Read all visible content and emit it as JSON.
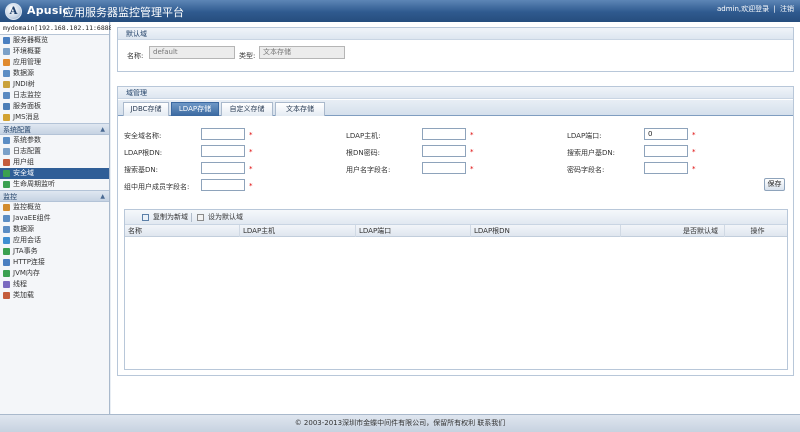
{
  "header": {
    "brand": "Apusic",
    "subtitle": "应用服务器监控管理平台",
    "user_status": "admin,欢迎登录",
    "separator": "|",
    "logout": "注销"
  },
  "sidebar": {
    "domain": "mydomain[192.168.102.11:6888]",
    "items_top": [
      {
        "label": "服务器概览",
        "color": "#4a7fc1"
      },
      {
        "label": "环境概要",
        "color": "#7aa0c8"
      },
      {
        "label": "应用管理",
        "color": "#e08a2e"
      },
      {
        "label": "数据源",
        "color": "#5b8dc4"
      },
      {
        "label": "JNDI树",
        "color": "#c9a23c"
      },
      {
        "label": "日志监控",
        "color": "#5a8ac2"
      },
      {
        "label": "服务面板",
        "color": "#4d7fb8"
      },
      {
        "label": "JMS消息",
        "color": "#d2a232"
      }
    ],
    "section_config": "系统配置",
    "items_config": [
      {
        "label": "系统参数",
        "color": "#5b8dc4"
      },
      {
        "label": "日志配置",
        "color": "#7aa0c8"
      },
      {
        "label": "用户组",
        "color": "#c45c3c"
      },
      {
        "label": "安全域",
        "color": "#3aa050",
        "active": true
      },
      {
        "label": "生命周期监听",
        "color": "#3aa050"
      }
    ],
    "section_monitor": "监控",
    "items_monitor": [
      {
        "label": "监控概览",
        "color": "#d28b2e"
      },
      {
        "label": "JavaEE组件",
        "color": "#5b8dc4"
      },
      {
        "label": "数据源",
        "color": "#5b8dc4"
      },
      {
        "label": "应用会话",
        "color": "#3f8fd2"
      },
      {
        "label": "JTA事务",
        "color": "#3aa050"
      },
      {
        "label": "HTTP连接",
        "color": "#4a7fc1"
      },
      {
        "label": "JVM内存",
        "color": "#3aa050"
      },
      {
        "label": "线程",
        "color": "#7a6ac0"
      },
      {
        "label": "类加载",
        "color": "#c45c3c"
      }
    ]
  },
  "default_domain": {
    "title": "默认域",
    "name_label": "名称:",
    "name_value": "default",
    "type_label": "类型:",
    "type_value": "文本存储"
  },
  "domain_mgmt": {
    "title": "域管理",
    "tabs": [
      "JDBC存储",
      "LDAP存储",
      "自定义存储",
      "文本存储"
    ],
    "active_tab": 1,
    "fields": {
      "domain_name": "安全域名称:",
      "ldap_host": "LDAP主机:",
      "ldap_port": "LDAP端口:",
      "ldap_port_value": "0",
      "ldap_root_dn": "LDAP根DN:",
      "root_dn_password": "根DN密码:",
      "search_user_base_dn": "搜索用户基DN:",
      "search_group_base_dn": "搜索基DN:",
      "username_field": "用户名字段名:",
      "password_field": "密码字段名:",
      "group_member_field": "组中用户成员字段名:"
    },
    "required": "*",
    "save": "保存",
    "toolbar": {
      "copy_new": "复制为新域",
      "set_default": "设为默认域"
    },
    "columns": [
      "名称",
      "LDAP主机",
      "LDAP端口",
      "LDAP根DN",
      "是否默认域",
      "操作"
    ]
  },
  "footer": "© 2003-2013深圳市金蝶中间件有限公司，保留所有权利  联系我们"
}
